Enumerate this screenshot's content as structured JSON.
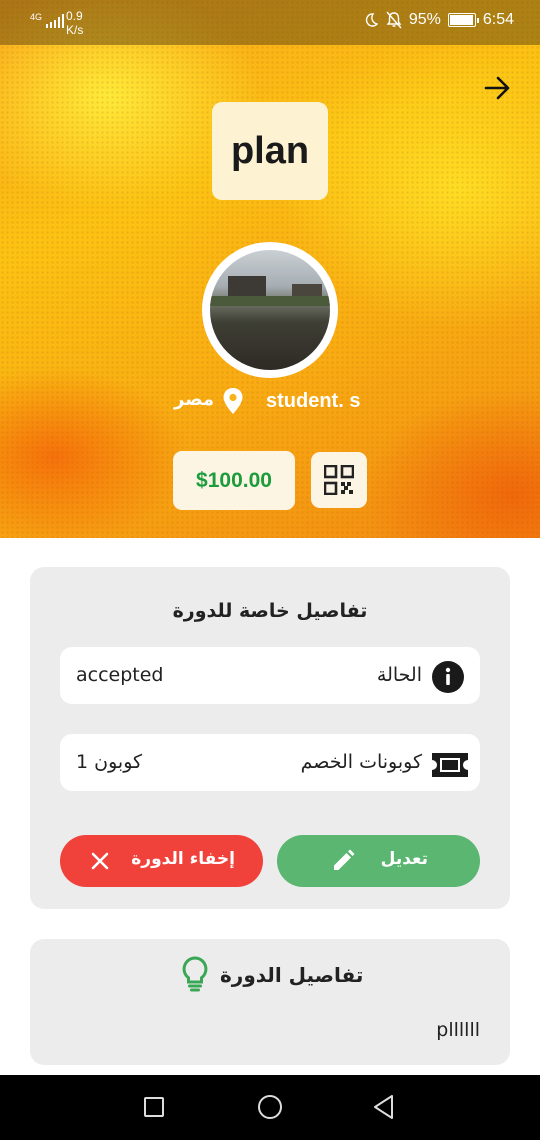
{
  "status_bar": {
    "network": "4G",
    "speed_value": "0.9",
    "speed_unit": "K/s",
    "battery": "95%",
    "time": "6:54"
  },
  "header": {
    "logo_text": "plan",
    "student_name": "student. s",
    "location": "مصر",
    "price": "$100.00"
  },
  "special_details": {
    "title": "تفاصيل خاصة للدورة",
    "status_label": "الحالة",
    "status_value": "accepted",
    "coupons_label": "كوبونات الخصم",
    "coupons_value": "1 كوبون",
    "edit_label": "تعديل",
    "hide_label": "إخفاء الدورة"
  },
  "course_details": {
    "title": "تفاصيل الدورة",
    "text": "pllllll"
  },
  "colors": {
    "accent_green": "#5ab671",
    "danger_red": "#f0413b",
    "price_green": "#1c9c3c",
    "hero_yellow": "#fbc313"
  },
  "icons": [
    "back-arrow-icon",
    "location-pin-icon",
    "qr-code-icon",
    "info-icon",
    "ticket-icon",
    "pencil-icon",
    "close-icon",
    "lightbulb-icon"
  ]
}
